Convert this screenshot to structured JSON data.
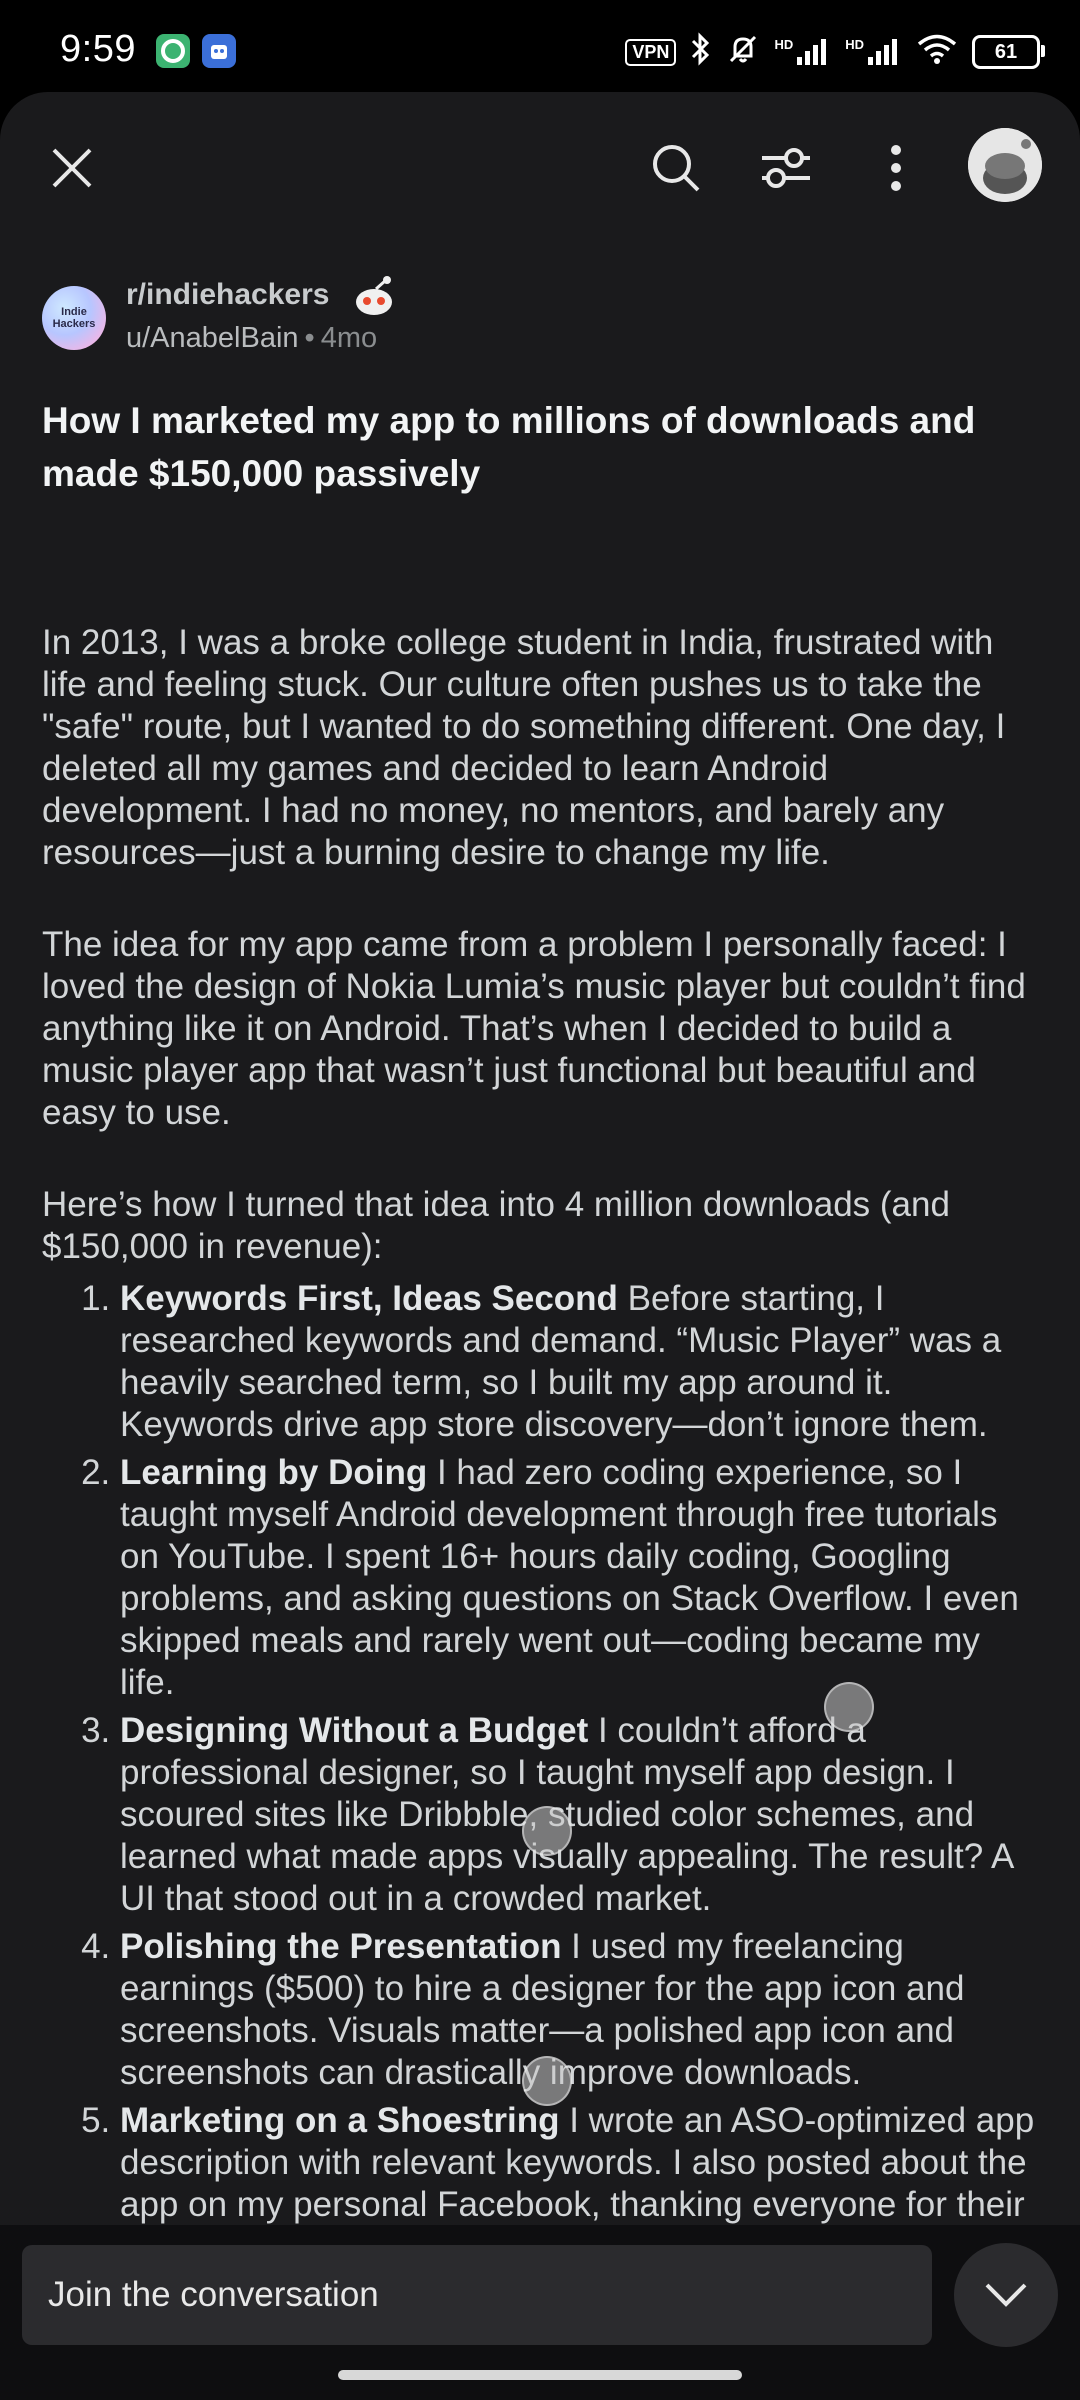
{
  "status_bar": {
    "time": "9:59",
    "vpn_label": "VPN",
    "signal_1_label": "HD",
    "signal_2_label": "HD",
    "battery_level": "61"
  },
  "toolbar": {
    "icons": [
      "close-icon",
      "search-icon",
      "filter-icon",
      "more-icon",
      "avatar"
    ]
  },
  "post": {
    "subreddit": "r/indiehackers",
    "subreddit_avatar_text": "Indie Hackers",
    "author": "u/AnabelBain",
    "age": "4mo",
    "title": "How I marketed my app to millions of downloads and made $150,000 passively",
    "paragraphs": [
      "In 2013, I was a broke college student in India, frustrated with life and feeling stuck. Our culture often pushes us to take the \"safe\" route, but I wanted to do something different. One day, I deleted all my games and decided to learn Android development. I had no money, no mentors, and barely any resources—just a burning desire to change my life.",
      "The idea for my app came from a problem I personally faced: I loved the design of Nokia Lumia’s music player but couldn’t find anything like it on Android. That’s when I decided to build a music player app that wasn’t just functional but beautiful and easy to use.",
      "Here’s how I turned that idea into 4 million downloads (and $150,000 in revenue):"
    ],
    "list": [
      {
        "heading": "Keywords First, Ideas Second",
        "text": " Before starting, I researched keywords and demand. “Music Player” was a heavily searched term, so I built my app around it. Keywords drive app store discovery—don’t ignore them."
      },
      {
        "heading": "Learning by Doing",
        "text": " I had zero coding experience, so I taught myself Android development through free tutorials on YouTube. I spent 16+ hours daily coding, Googling problems, and asking questions on Stack Overflow. I even skipped meals and rarely went out—coding became my life."
      },
      {
        "heading": "Designing Without a Budget",
        "text": " I couldn’t afford a professional designer, so I taught myself app design. I scoured sites like Dribbble, studied color schemes, and learned what made apps visually appealing. The result? A UI that stood out in a crowded market."
      },
      {
        "heading": "Polishing the Presentation",
        "text": " I used my freelancing earnings ($500) to hire a designer for the app icon and screenshots. Visuals matter—a polished app icon and screenshots can drastically improve downloads."
      },
      {
        "heading": "Marketing on a Shoestring",
        "text": " I wrote an ASO-optimized app description with relevant keywords. I also posted about the app on my personal Facebook, thanking everyone for their support, which generated downloads through word of mouth."
      }
    ]
  },
  "comment_bar": {
    "placeholder": "Join the conversation"
  },
  "colors": {
    "background": "#1a1a1c",
    "text": "#d2d5d7",
    "title": "#f2f4f5",
    "muted": "#8a8d8f"
  }
}
